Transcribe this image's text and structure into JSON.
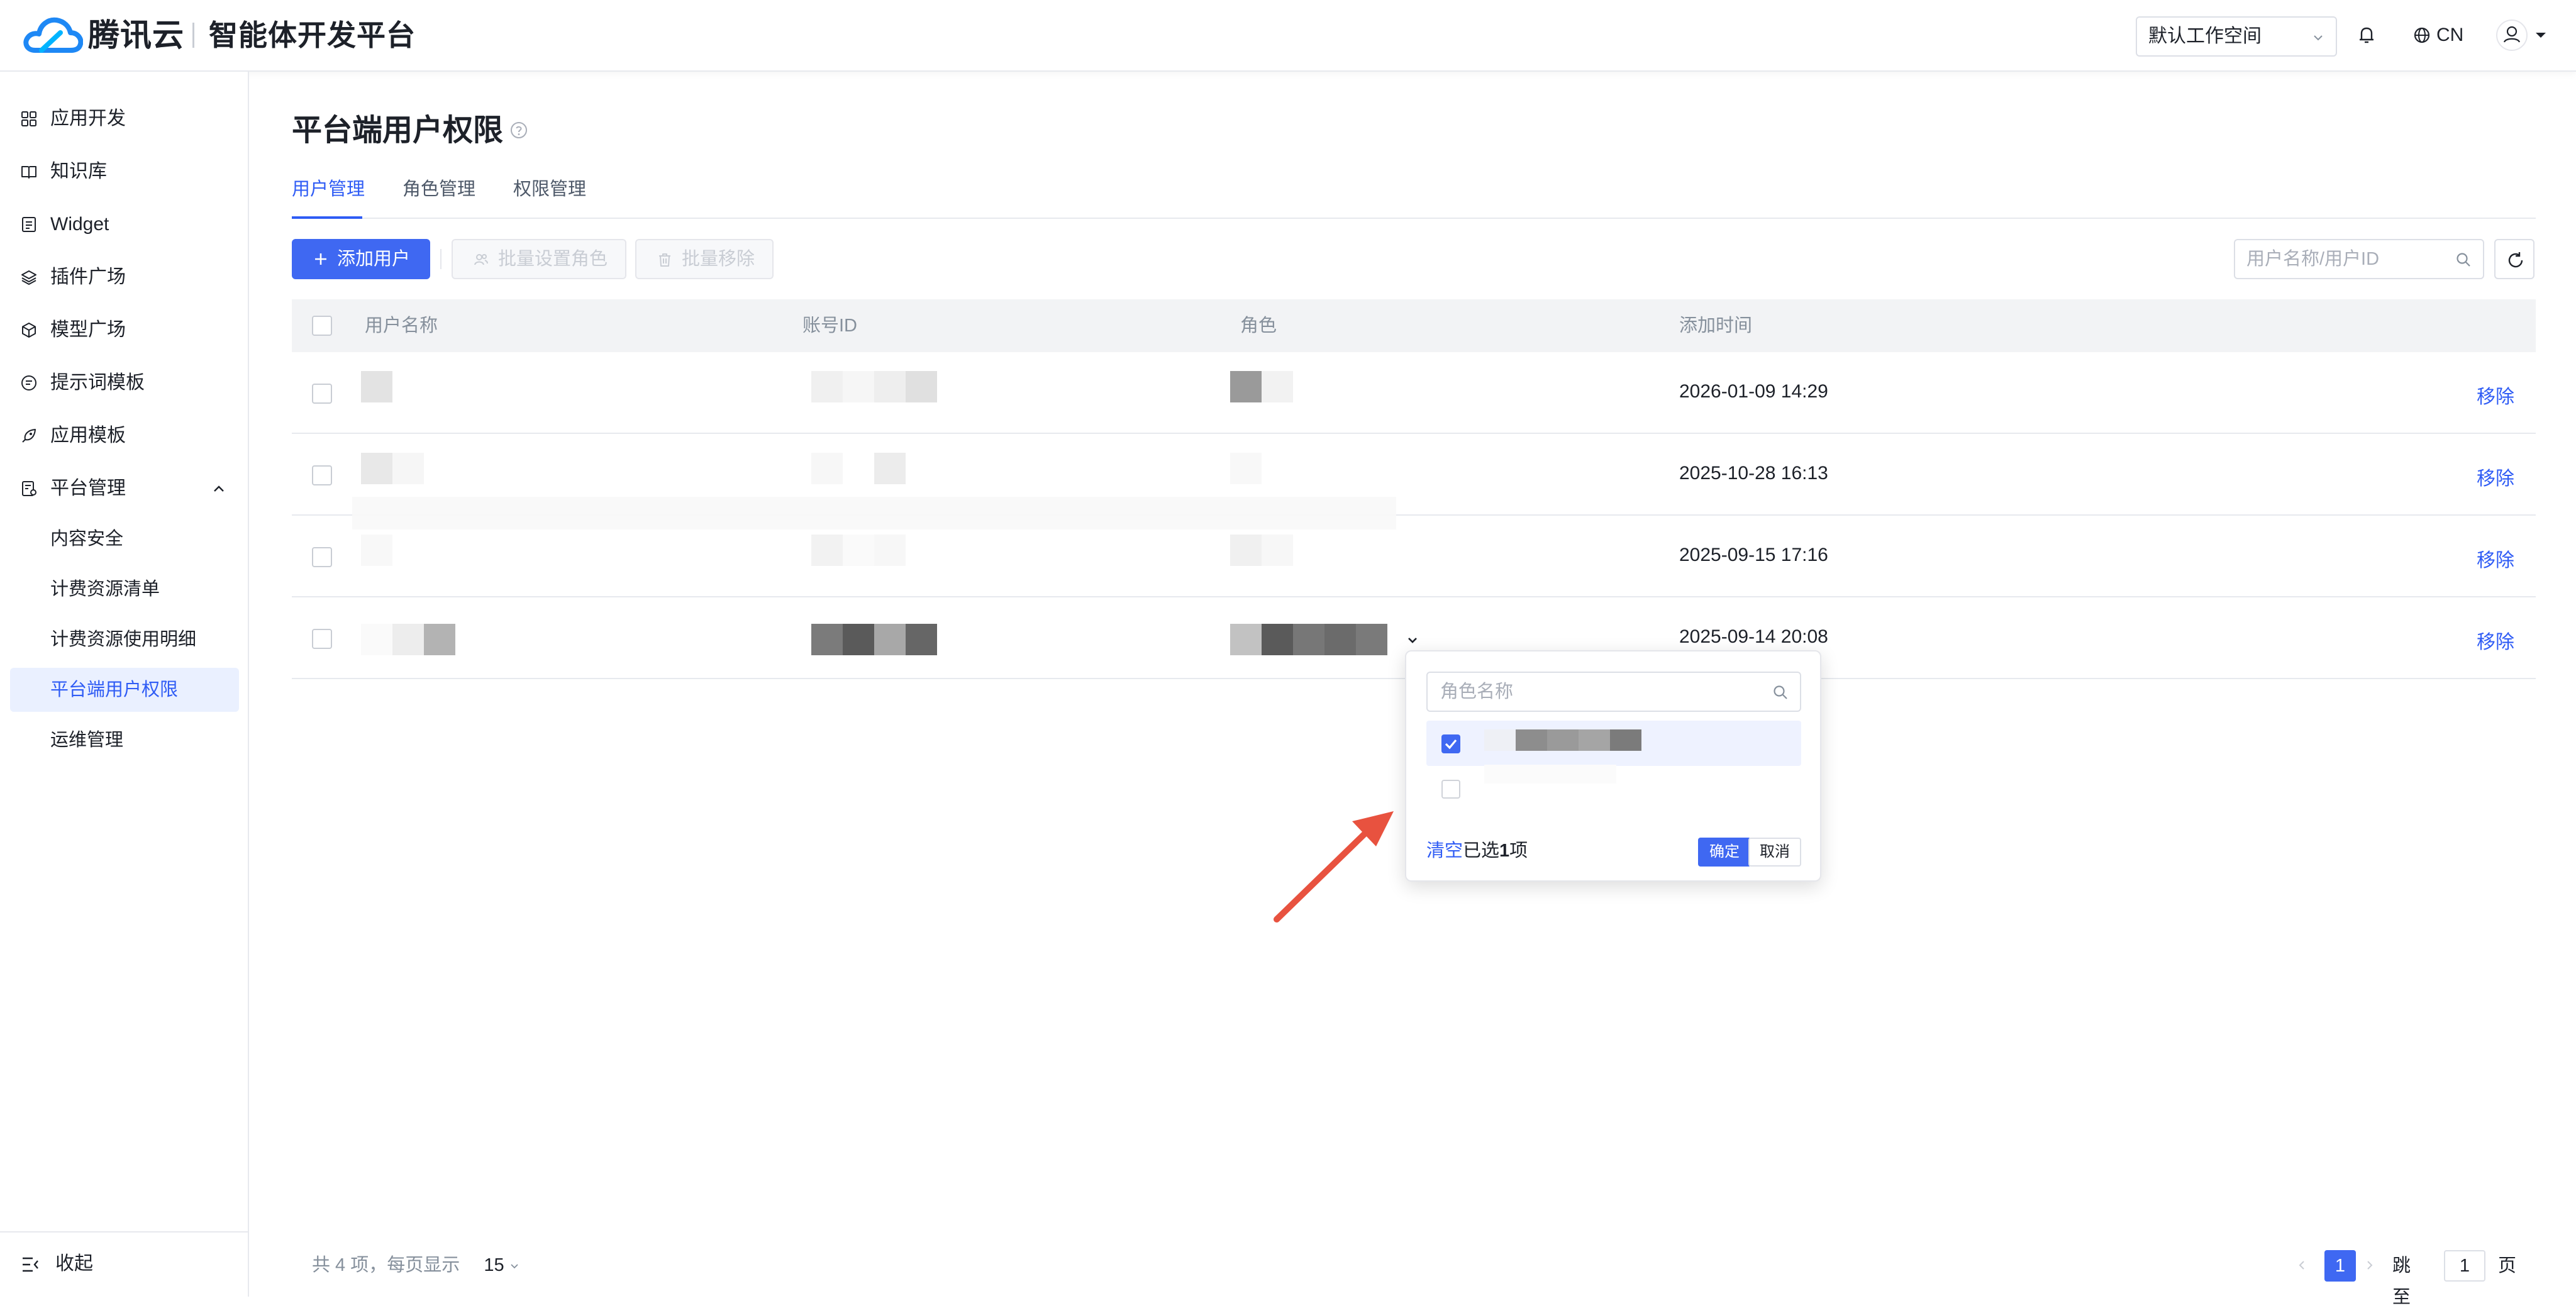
{
  "header": {
    "brand": "腾讯云",
    "product": "智能体开发平台",
    "workspace": "默认工作空间",
    "language": "CN"
  },
  "sidebar": {
    "items": [
      {
        "label": "应用开发",
        "icon": "grid-icon"
      },
      {
        "label": "知识库",
        "icon": "book-icon"
      },
      {
        "label": "Widget",
        "icon": "widget-icon"
      },
      {
        "label": "插件广场",
        "icon": "layers-icon"
      },
      {
        "label": "模型广场",
        "icon": "cube-icon"
      },
      {
        "label": "提示词模板",
        "icon": "prompt-icon"
      },
      {
        "label": "应用模板",
        "icon": "rocket-icon"
      },
      {
        "label": "平台管理",
        "icon": "manage-icon"
      }
    ],
    "sub_items": [
      "内容安全",
      "计费资源清单",
      "计费资源使用明细",
      "平台端用户权限",
      "运维管理"
    ],
    "collapse": "收起"
  },
  "page": {
    "title": "平台端用户权限",
    "tabs": [
      "用户管理",
      "角色管理",
      "权限管理"
    ],
    "add_user": "添加用户",
    "batch_role": "批量设置角色",
    "batch_remove": "批量移除",
    "search_placeholder": "用户名称/用户ID"
  },
  "table": {
    "columns": [
      "用户名称",
      "账号ID",
      "角色",
      "添加时间"
    ],
    "rows": [
      {
        "time": "2026-01-09 14:29",
        "action": "移除"
      },
      {
        "time": "2025-10-28 16:13",
        "action": "移除"
      },
      {
        "time": "2025-09-15 17:16",
        "action": "移除"
      },
      {
        "time": "2025-09-14 20:08",
        "action": "移除"
      }
    ]
  },
  "dropdown": {
    "search_placeholder": "角色名称",
    "clear": "清空",
    "selected_prefix": "已选",
    "selected_count": "1",
    "selected_suffix": "项",
    "confirm": "确定",
    "cancel": "取消"
  },
  "pagination": {
    "total_text": "共 4 项，每页显示",
    "page_size": "15",
    "current": "1",
    "jump_label": "跳至",
    "jump_value": "1",
    "page_unit": "页"
  },
  "colors": {
    "primary": "#3f68f2",
    "link": "#2f5cf5",
    "annotation_arrow": "#e8523f"
  }
}
